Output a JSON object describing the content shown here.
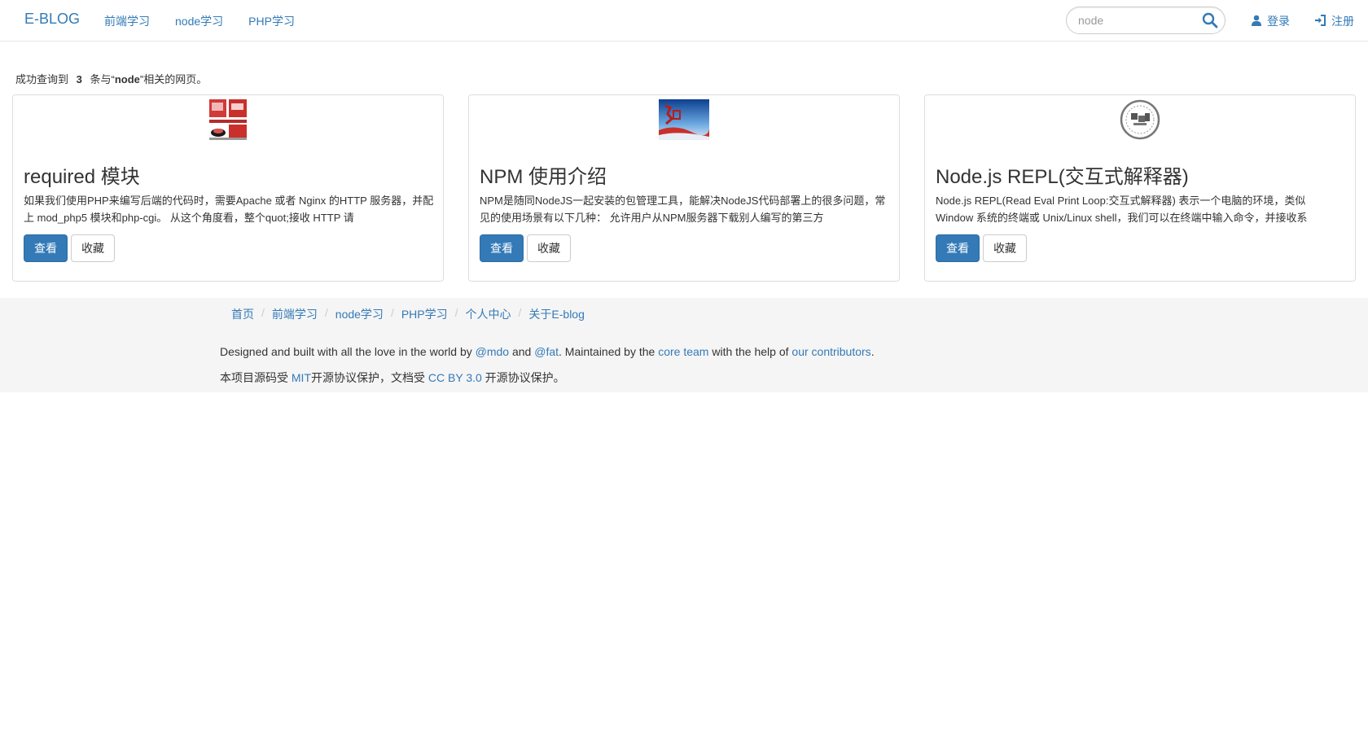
{
  "navbar": {
    "brand": "E-BLOG",
    "links": [
      "前端学习",
      "node学习",
      "PHP学习"
    ],
    "search": {
      "value": "node",
      "placeholder": ""
    },
    "login": "登录",
    "register": "注册"
  },
  "results": {
    "prefix": "成功查询到",
    "count": "3",
    "middle": "条与“",
    "keyword": "node",
    "suffix": "”相关的网页。"
  },
  "cards": [
    {
      "title": "required 模块",
      "desc": "如果我们使用PHP来编写后端的代码时，需要Apache 或者 Nginx 的HTTP 服务器，并配上 mod_php5 模块和php-cgi。 从这个角度看，整个quot;接收 HTTP 请",
      "view_label": "查看",
      "fav_label": "收藏",
      "thumb_icon": "book-cover-thumbnail"
    },
    {
      "title": "NPM 使用介绍",
      "desc": "NPM是随同NodeJS一起安装的包管理工具，能解决NodeJS代码部署上的很多问题，常见的使用场景有以下几种： 允许用户从NPM服务器下载别人编写的第三方",
      "view_label": "查看",
      "fav_label": "收藏",
      "thumb_icon": "china-poster-thumbnail"
    },
    {
      "title": "Node.js REPL(交互式解释器)",
      "desc": "Node.js REPL(Read Eval Print Loop:交互式解释器) 表示一个电脑的环境，类似 Window 系统的终端或 Unix/Linux shell，我们可以在终端中输入命令，并接收系",
      "view_label": "查看",
      "fav_label": "收藏",
      "thumb_icon": "stamp-seal-thumbnail"
    }
  ],
  "footer": {
    "breadcrumb": [
      "首页",
      "前端学习",
      "node学习",
      "PHP学习",
      "个人中心",
      "关于E-blog"
    ],
    "line1": {
      "t1": "Designed and built with all the love in the world by ",
      "l1": "@mdo",
      "t2": " and ",
      "l2": "@fat",
      "t3": ". Maintained by the ",
      "l3": "core team",
      "t4": " with the help of ",
      "l4": "our contributors",
      "t5": "."
    },
    "line2": {
      "t1": "本项目源码受 ",
      "l1": "MIT",
      "t2": "开源协议保护，文档受 ",
      "l2": "CC BY 3.0",
      "t3": " 开源协议保护。"
    }
  },
  "colors": {
    "link": "#337ab7",
    "primary_button": "#337ab7",
    "footer_bg": "#f5f5f5"
  }
}
